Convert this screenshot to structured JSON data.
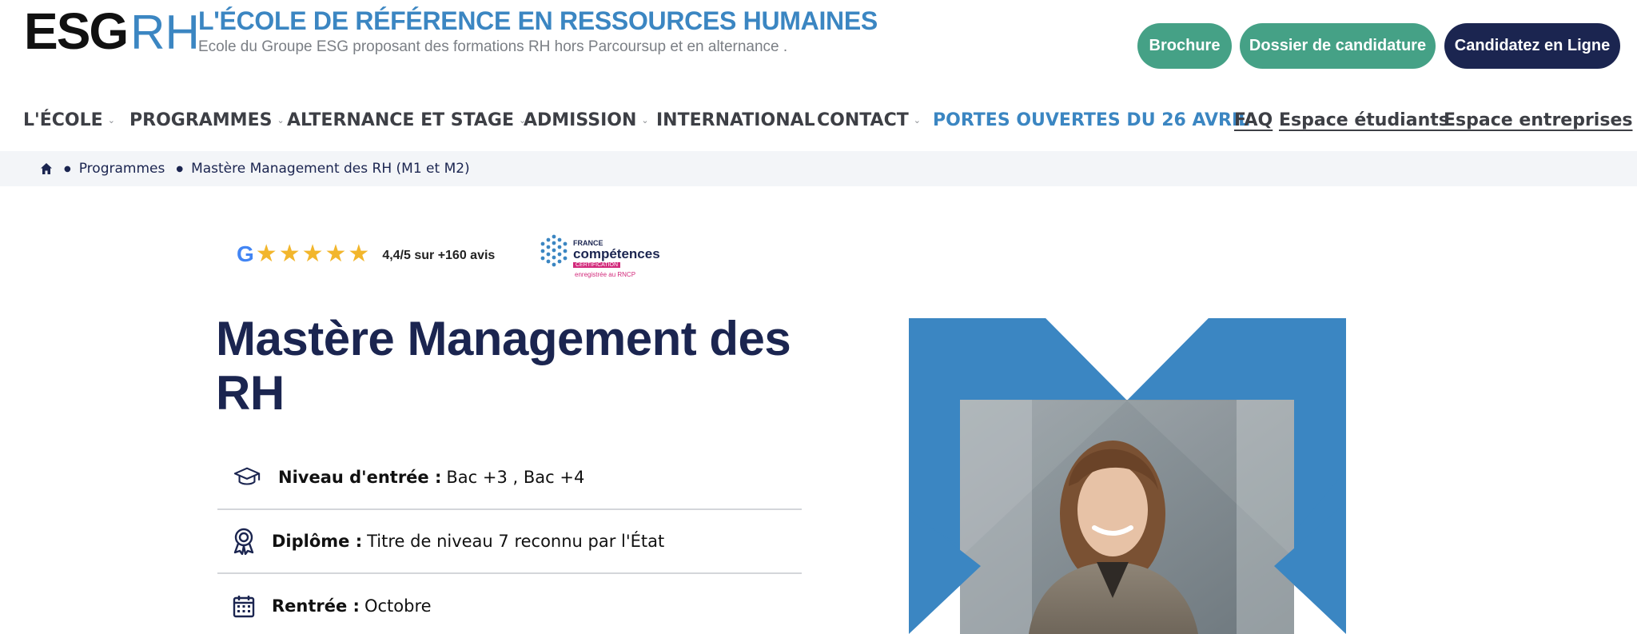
{
  "header": {
    "logo_main": "ESG",
    "logo_accent": "RH",
    "tagline_title": "L'ÉCOLE DE RÉFÉRENCE EN RESSOURCES HUMAINES",
    "tagline_sub": "Ecole du Groupe ESG proposant des formations RH hors Parcoursup et en alternance .",
    "buttons": {
      "brochure": "Brochure",
      "dossier": "Dossier de candidature",
      "candidatez": "Candidatez en Ligne"
    }
  },
  "nav": {
    "items": [
      {
        "label": "L'ÉCOLE",
        "dropdown": true
      },
      {
        "label": "PROGRAMMES",
        "dropdown": true
      },
      {
        "label": "ALTERNANCE ET STAGE",
        "dropdown": true
      },
      {
        "label": "ADMISSION",
        "dropdown": true
      },
      {
        "label": "INTERNATIONAL",
        "dropdown": false
      },
      {
        "label": "CONTACT",
        "dropdown": true
      },
      {
        "label": "PORTES OUVERTES DU 26 AVRIL",
        "dropdown": false
      }
    ],
    "links": [
      "FAQ",
      "Espace étudiants",
      "Espace entreprises"
    ]
  },
  "breadcrumb": {
    "home_icon": "home-icon",
    "items": [
      "Programmes",
      "Mastère Management des RH (M1 et M2)"
    ]
  },
  "rating": {
    "google_letter": "G",
    "stars": 5,
    "text": "4,4/5 sur +160 avis"
  },
  "certification": {
    "france": "FRANCE",
    "competences": "compétences",
    "label": "CERTIFICATION",
    "rncp": "enregistrée au RNCP"
  },
  "main": {
    "title": "Mastère Management des RH",
    "info": [
      {
        "icon": "graduation-cap-icon",
        "key": "Niveau d'entrée :",
        "value": "Bac +3 , Bac +4"
      },
      {
        "icon": "award-icon",
        "key": "Diplôme :",
        "value": "Titre de niveau 7 reconnu par l'État"
      },
      {
        "icon": "calendar-icon",
        "key": "Rentrée :",
        "value": "Octobre"
      }
    ]
  },
  "colors": {
    "brand_blue": "#3b86c2",
    "navy": "#1b2550",
    "green": "#45a186",
    "breadcrumb_bg": "#f3f5f8"
  }
}
